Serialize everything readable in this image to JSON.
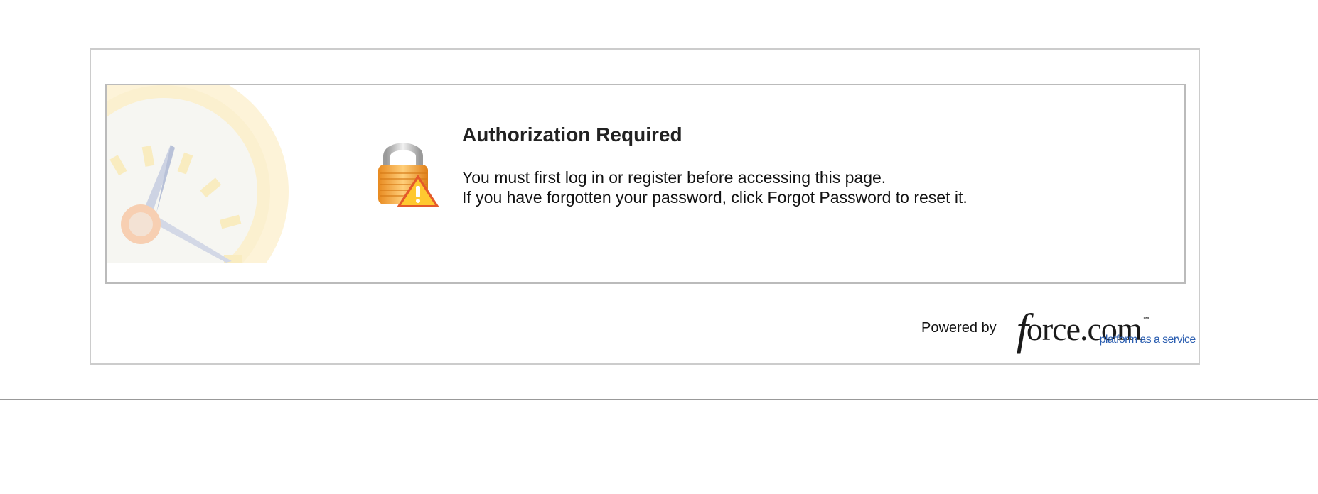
{
  "error": {
    "title": "Authorization Required",
    "lines": [
      "You must first log in or register before accessing this page.",
      "If you have forgotten your password, click Forgot Password to reset it."
    ]
  },
  "footer": {
    "powered_by": "Powered by",
    "logo_wordmark_f": "f",
    "logo_wordmark_rest": "orce.com",
    "logo_tm": "™",
    "logo_tagline": "platform as a service"
  },
  "icons": {
    "lock": "lock-warning-icon",
    "watermark": "clock-icon"
  },
  "colors": {
    "frame_border": "#cccccc",
    "panel_border": "#bbbbbb",
    "tagline_blue": "#2a5db0",
    "lock_orange": "#f0a030",
    "warning_red": "#e04a2a",
    "warning_yellow": "#ffc830"
  }
}
